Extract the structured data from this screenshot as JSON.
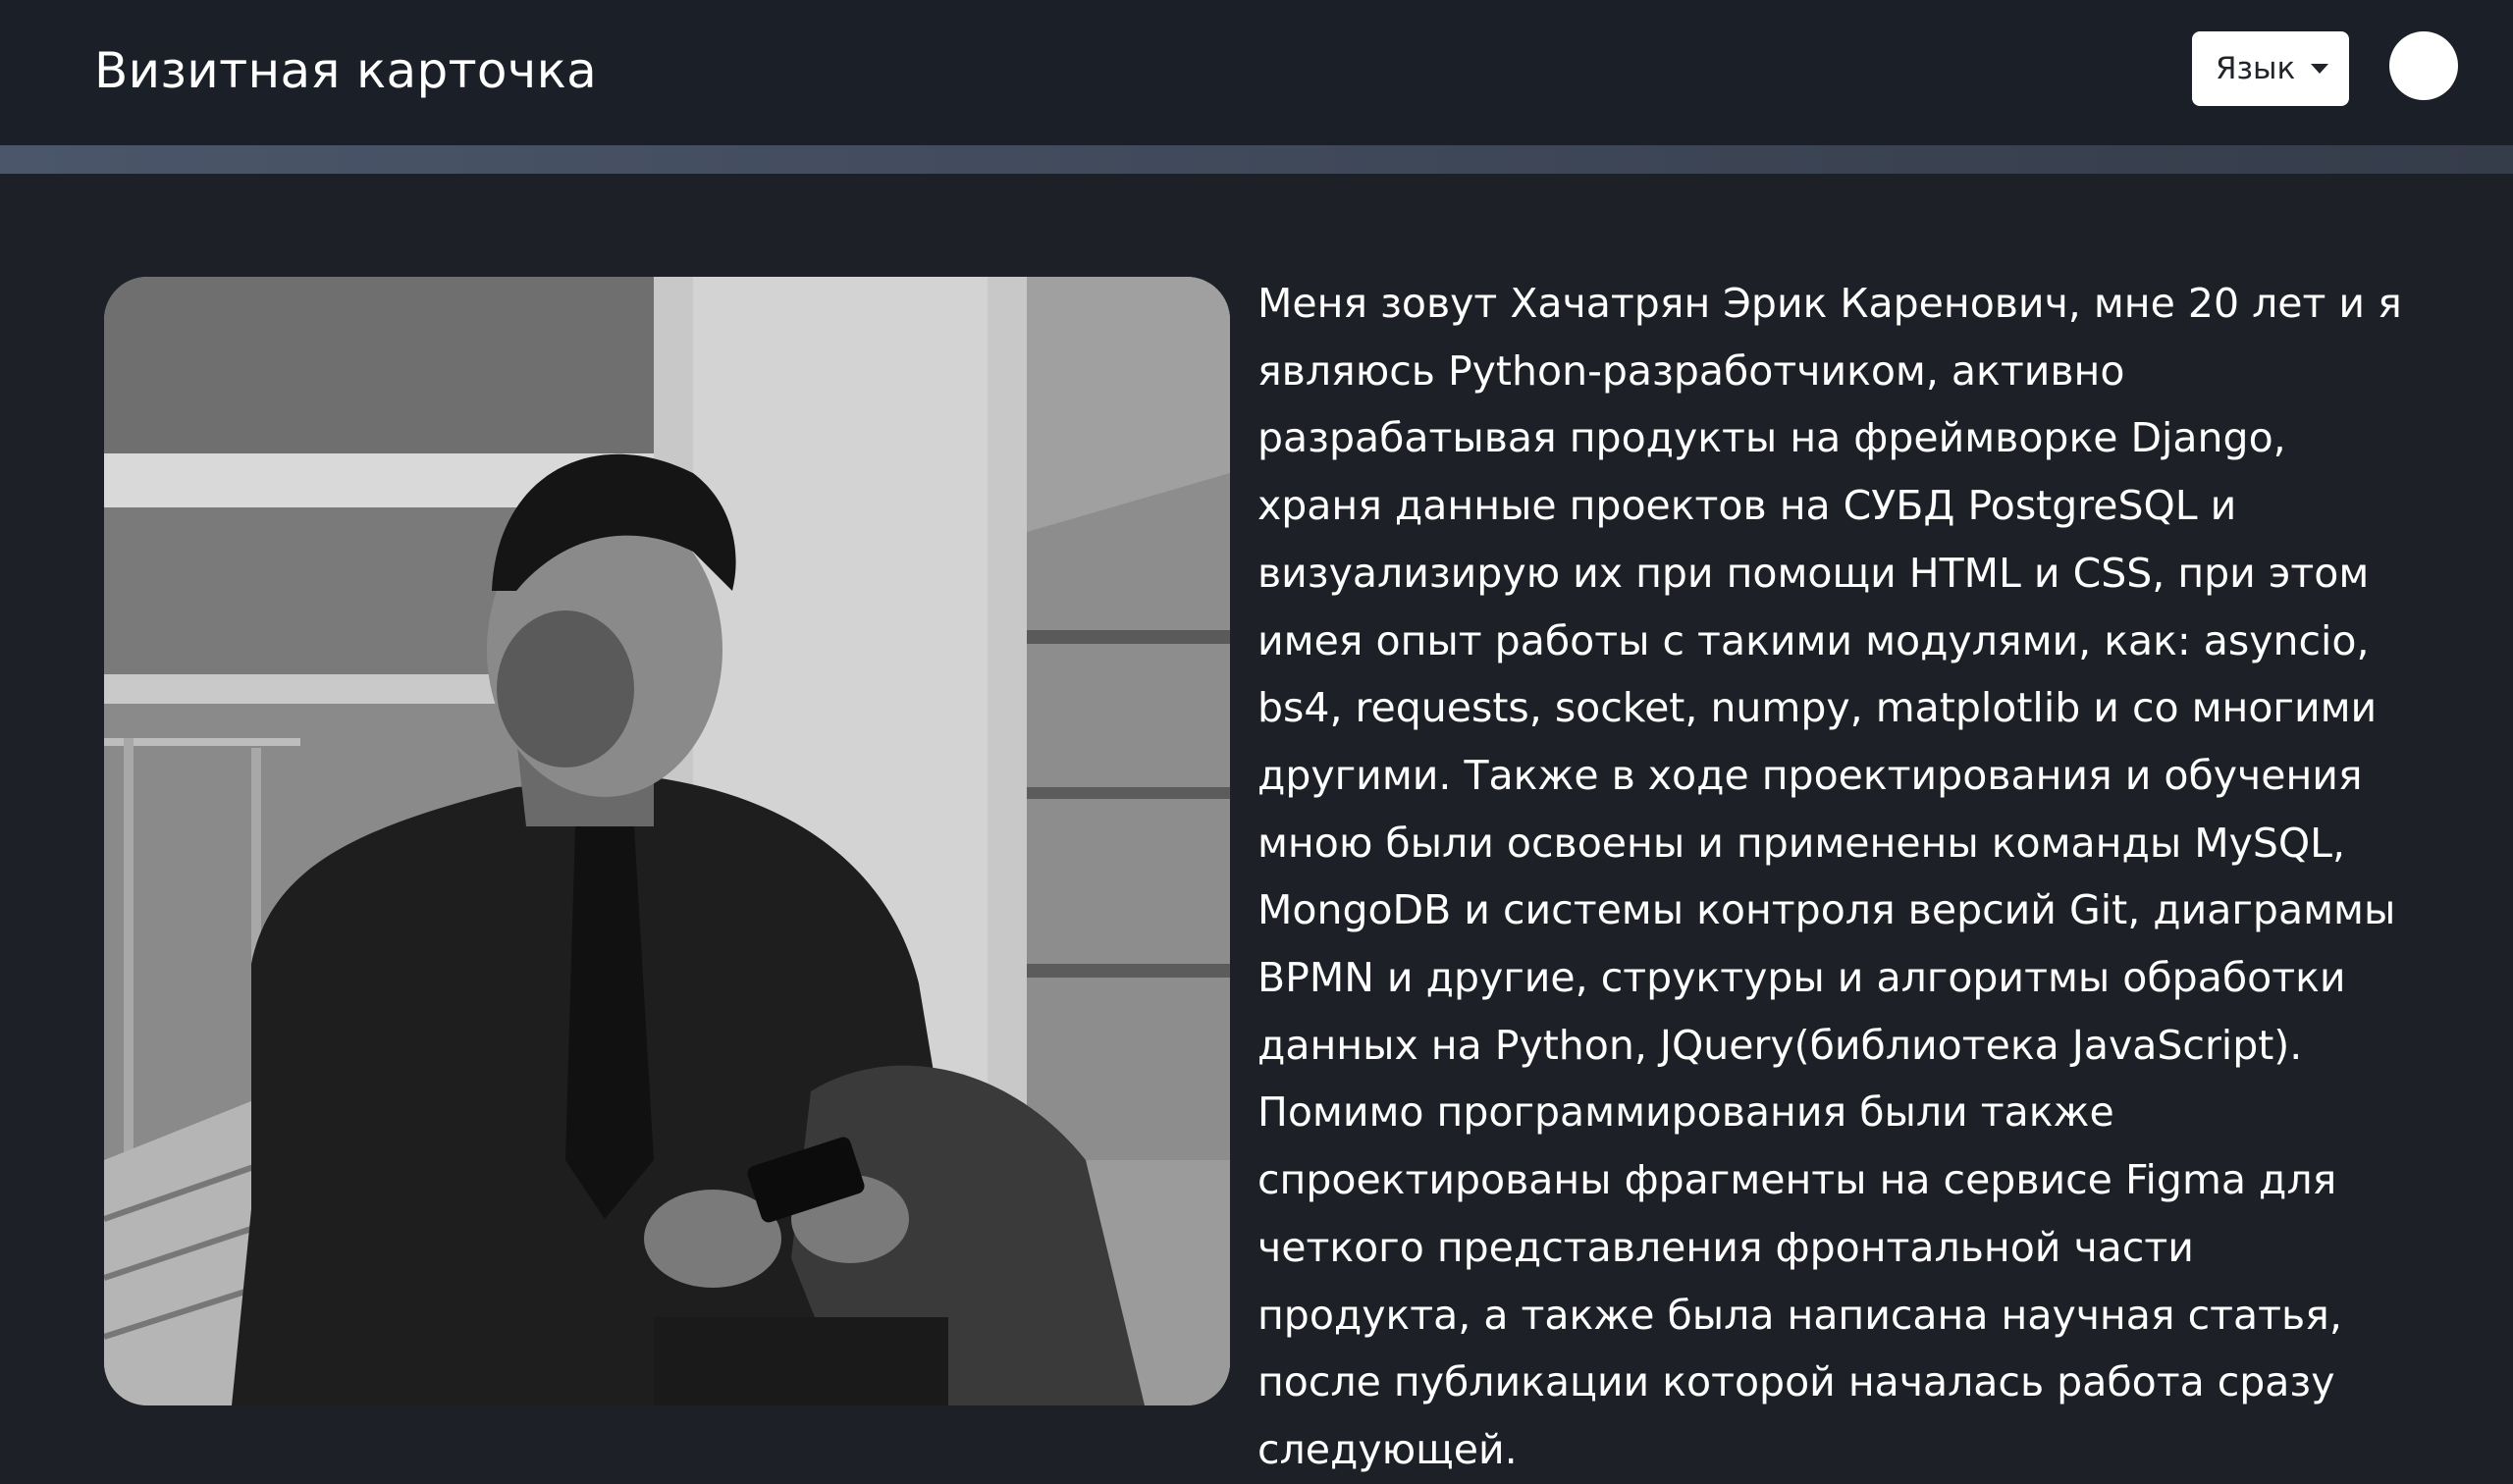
{
  "navbar": {
    "brand": "Визитная карточка",
    "language_button_label": "Язык"
  },
  "profile": {
    "photo_icon": "portrait-photo",
    "bio_text": "Меня зовут Хачатрян Эрик Каренович, мне 20 лет и я являюсь Python-разработчиком, активно разрабатывая продукты на фреймворке Django, храня данные проектов на СУБД PostgreSQL и визуализирую их при помощи HTML и CSS, при этом имея опыт работы с такими модулями, как: asyncio, bs4, requests, socket, numpy, matplotlib и со многими другими. Также в ходе проектирования и обучения мною были освоены и применены команды MySQL, MongoDB и системы контроля версий Git, диаграммы BPMN и другие, структуры и алгоритмы обработки данных на Python, JQuery(библиотека JavaScript). Помимо программирования были также спроектированы фрагменты на сервисе Figma для четкого представления фронтальной части продукта, а также была написана научная статья, после публикации которой началась работа сразу следующей."
  },
  "colors": {
    "navbar_bg": "#1b1f27",
    "page_bg": "#1d2026",
    "divider": "#4b566a",
    "text": "#ffffff"
  }
}
